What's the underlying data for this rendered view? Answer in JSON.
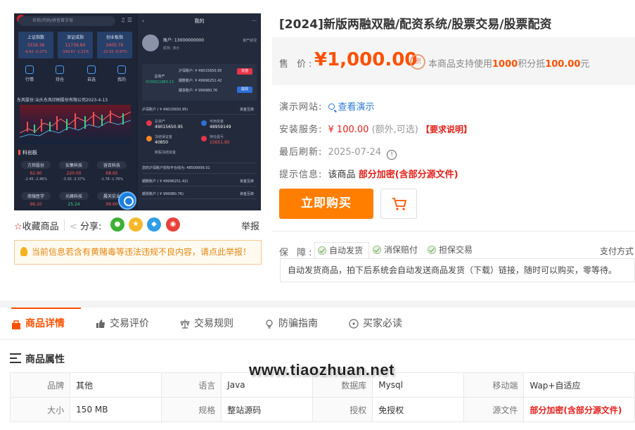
{
  "preview": {
    "left_screen": {
      "search_placeholder": "名称/代码/拼音首字母",
      "indices": [
        {
          "name": "上证指数",
          "value": "3318.36",
          "change": "-6.62  -0.27%"
        },
        {
          "name": "深证成指",
          "value": "11739.84",
          "change": "-143.67 -1.21%"
        },
        {
          "name": "创业板指",
          "value": "2405.76",
          "change": "-23.33 -0.97%"
        }
      ],
      "nav": [
        "行情",
        "持仓",
        "自选",
        "我的"
      ],
      "news": "东风股份:汕头东风印刷股份有限公司2023-4-13",
      "board_title": "科创板",
      "stocks": [
        {
          "name": "方邦股份",
          "price": "62.90",
          "change": "-2.45  -2.46%"
        },
        {
          "name": "安集科技",
          "price": "220.00",
          "change": "-3.30  -3.37%"
        },
        {
          "name": "容百科技",
          "price": "68.65",
          "change": "-1.78  -1.78%"
        },
        {
          "name": "南微医学",
          "price": "96.10",
          "change": ""
        },
        {
          "name": "光峰科技",
          "price": "25.24",
          "change": ""
        },
        {
          "name": "晨天实业",
          "price": "99.60",
          "change": ""
        }
      ]
    },
    "right_screen": {
      "header": "我的",
      "account": "账户: 13000000000",
      "account_sub": "昵称: 演示",
      "status": "资产状况",
      "total_label": "总资产",
      "total_amount": "¥100011883.13",
      "rows": [
        "沪深账户: ¥ 49015650.95",
        "期数账户: ¥ 49996251.42",
        "期货账户: ¥ 999980.76"
      ],
      "btn_recharge": "充值",
      "btn_withdraw": "提现",
      "section1": "沪深账户 ( ¥ 49015650.95)",
      "section1_right": "资金互转",
      "kv": [
        {
          "k": "总资产",
          "v": "49015650.95"
        },
        {
          "k": "可用资金",
          "v": "48959149"
        },
        {
          "k": "冻结保证金",
          "v": "40850"
        },
        {
          "k": "持仓盈亏",
          "v": "15651.95"
        }
      ],
      "kv_extra": "新股冻结资金",
      "limit_text": "您的沪深账户授标平仓线为: 48509999.01",
      "section2": "期数账户 ( ¥ 49996251.42)",
      "section3": "期货账户 ( ¥ 999980.76)",
      "section_right": "资金互转"
    }
  },
  "product": {
    "title": "[2024]新版两融双融/配资系统/股票交易/股票配资",
    "price_label": "售 价:",
    "price": "¥1,000.00",
    "points_icon": "积",
    "points_text_pre": "本商品支持使用",
    "points_amount": "1000",
    "points_text_mid": "积分抵",
    "points_value": "100.00",
    "points_text_post": "元",
    "demo_label": "演示网站:",
    "demo_link": "查看演示",
    "install_label": "安装服务:",
    "install_price": "¥ 100.00",
    "install_note": "(额外,可选)",
    "install_req": "【要求说明】",
    "refresh_label": "最后刷新:",
    "refresh_date": "2025-07-24",
    "hint_label": "提示信息:",
    "hint_pre": "该商品",
    "hint_bold": "部分加密(含部分源文件)",
    "buy_button": "立即购买",
    "guarantee_label": "保 障:",
    "guarantees": [
      "自动发货",
      "消保赔付",
      "担保交易"
    ],
    "pay_method": "支付方式",
    "guarantee_desc": "自动发货商品，拍下后系统会自动发送商品发货（下载）链接，随时可以购买，零等待。"
  },
  "actions": {
    "favorite": "收藏商品",
    "share": "分享:",
    "share_icons": [
      "wechat-icon",
      "qzone-icon",
      "qq-icon",
      "weibo-icon"
    ],
    "report": "举报",
    "notice": "当前信息若含有黄赌毒等违法违规不良内容，请点此举报！"
  },
  "tabs": [
    "商品详情",
    "交易评价",
    "交易规则",
    "防骗指南",
    "买家必读"
  ],
  "attributes": {
    "title": "商品属性",
    "rows": [
      [
        {
          "k": "品牌",
          "v": "其他"
        },
        {
          "k": "语言",
          "v": "Java"
        },
        {
          "k": "数据库",
          "v": "Mysql"
        },
        {
          "k": "移动端",
          "v": "Wap+自适应"
        }
      ],
      [
        {
          "k": "大小",
          "v": "150 MB"
        },
        {
          "k": "规格",
          "v": "整站源码"
        },
        {
          "k": "授权",
          "v": "免授权"
        },
        {
          "k": "源文件",
          "v": "部分加密(含部分源文件)"
        }
      ]
    ]
  },
  "watermark": "www.tiaozhuan.net",
  "colors": {
    "accent": "#ff5000",
    "buy": "#ff7e00",
    "link": "#2d7bd6",
    "red": "#e3211c"
  }
}
